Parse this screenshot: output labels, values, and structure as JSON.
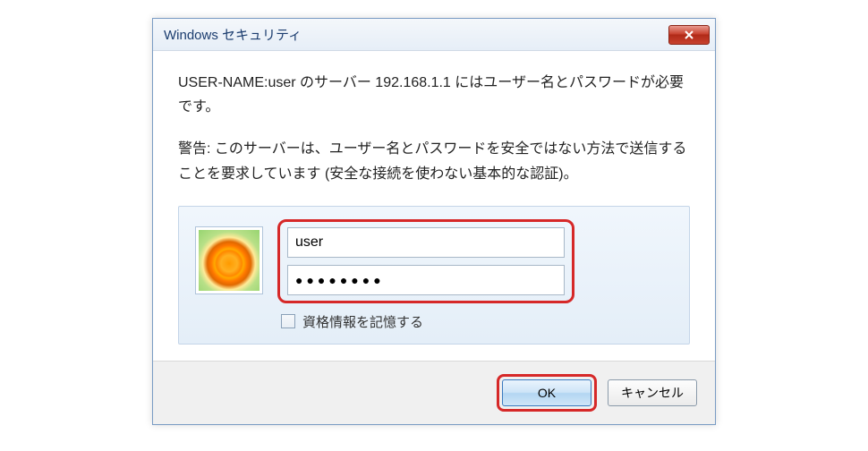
{
  "titlebar": {
    "title": "Windows セキュリティ"
  },
  "content": {
    "message": "USER-NAME:user のサーバー 192.168.1.1 にはユーザー名とパスワードが必要です。",
    "warning": "警告: このサーバーは、ユーザー名とパスワードを安全ではない方法で送信することを要求しています (安全な接続を使わない基本的な認証)。"
  },
  "credentials": {
    "username_value": "user",
    "password_value": "●●●●●●●●",
    "remember_label": "資格情報を記憶する"
  },
  "buttons": {
    "ok": "OK",
    "cancel": "キャンセル"
  }
}
